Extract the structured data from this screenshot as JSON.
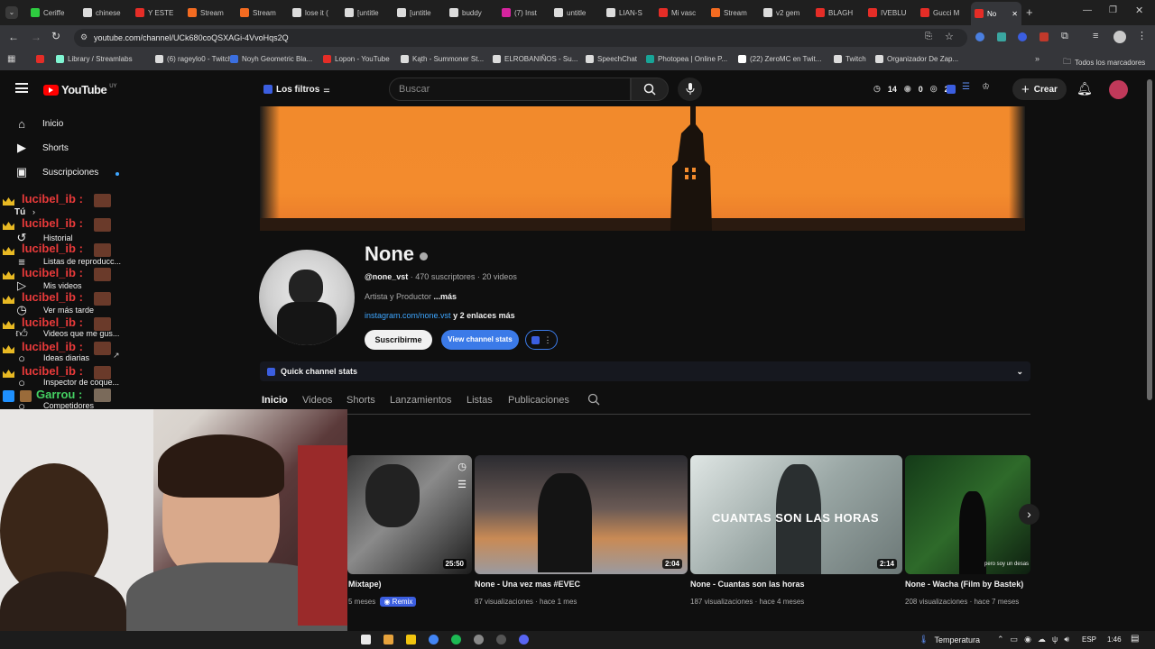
{
  "browser": {
    "tabs": [
      {
        "label": "Ceriffe",
        "color": "#2ecc40"
      },
      {
        "label": "chinese",
        "color": "#dcdcdc"
      },
      {
        "label": "Y ESTE",
        "color": "#e52d27"
      },
      {
        "label": "Stream",
        "color": "#f36b21"
      },
      {
        "label": "Stream",
        "color": "#f36b21"
      },
      {
        "label": "lose it (",
        "color": "#dcdcdc"
      },
      {
        "label": "[untitle",
        "color": "#dcdcdc"
      },
      {
        "label": "[untitle",
        "color": "#dcdcdc"
      },
      {
        "label": "buddy",
        "color": "#dcdcdc"
      },
      {
        "label": "(7) Inst",
        "color": "#d6249f"
      },
      {
        "label": "untitle",
        "color": "#dcdcdc"
      },
      {
        "label": "LIAN-S",
        "color": "#dcdcdc"
      },
      {
        "label": "Mi vasc",
        "color": "#e52d27"
      },
      {
        "label": "Stream",
        "color": "#f36b21"
      },
      {
        "label": "v2 gem",
        "color": "#dcdcdc"
      },
      {
        "label": "BLAGH",
        "color": "#e52d27"
      },
      {
        "label": "IVEBLU",
        "color": "#e52d27"
      },
      {
        "label": "Gucci M",
        "color": "#e52d27"
      },
      {
        "label": "No",
        "color": "#e52d27"
      }
    ],
    "url": "youtube.com/channel/UCk680coQSXAGi-4VvoHqs2Q",
    "bookmarks": [
      {
        "label": "",
        "color": "#e52d27"
      },
      {
        "label": "Library / Streamlabs",
        "color": "#80f5d2"
      },
      {
        "label": "(6) rageylo0 - Twitch",
        "color": "#dcdcdc"
      },
      {
        "label": "Noyh Geometric Bla...",
        "color": "#3b6fe0"
      },
      {
        "label": "Lopon - YouTube",
        "color": "#e52d27"
      },
      {
        "label": "Kąth - Summoner St...",
        "color": "#dcdcdc"
      },
      {
        "label": "ELROBANIÑOS - Su...",
        "color": "#dcdcdc"
      },
      {
        "label": "SpeechChat",
        "color": "#dcdcdc"
      },
      {
        "label": "Photopea | Online P...",
        "color": "#18a497"
      },
      {
        "label": "(22) ZeroMC en Twit...",
        "color": "#ffffff"
      },
      {
        "label": "Twitch",
        "color": "#dcdcdc"
      },
      {
        "label": "Organizador De Zap...",
        "color": "#dcdcdc"
      }
    ],
    "all_bookmarks": "Todos los marcadores"
  },
  "youtube": {
    "logo_text": "YouTube",
    "logo_country": "UY",
    "filter_label": "Los filtros",
    "search_placeholder": "Buscar",
    "stats": {
      "a": "14",
      "b": "0",
      "c": "2"
    },
    "create_label": "Crear",
    "sidebar": {
      "main": [
        {
          "label": "Inicio",
          "icon": "home-icon"
        },
        {
          "label": "Shorts",
          "icon": "shorts-icon"
        },
        {
          "label": "Suscripciones",
          "icon": "subscriptions-icon"
        }
      ],
      "you_label": "Tú",
      "you_items": [
        {
          "label": "Historial"
        },
        {
          "label": "Listas de reproducc..."
        },
        {
          "label": "Mis videos"
        },
        {
          "label": "Ver más tarde"
        },
        {
          "label": "Videos que me gus..."
        },
        {
          "label": "Ideas diarias"
        },
        {
          "label": "Inspector de coque..."
        },
        {
          "label": "Competidores"
        }
      ]
    },
    "chat": {
      "names": [
        "lucibel_ib :",
        "lucibel_ib :",
        "lucibel_ib :",
        "lucibel_ib :",
        "lucibel_ib :",
        "lucibel_ib :",
        "lucibel_ib :",
        "lucibel_ib :"
      ],
      "last_name": "Garrou :"
    },
    "channel": {
      "name": "None",
      "handle": "@none_vst",
      "subscribers": "470 suscriptores",
      "videos": "20 videos",
      "description": "Artista y Productor",
      "more": "...más",
      "link": "instagram.com/none.vst",
      "link_more": "y 2 enlaces más",
      "subscribe_label": "Suscribirme",
      "stats_label": "View channel stats",
      "quick_stats": "Quick channel stats",
      "tabs": [
        "Inicio",
        "Videos",
        "Shorts",
        "Lanzamientos",
        "Listas",
        "Publicaciones"
      ]
    },
    "videos": [
      {
        "title": "Mixtape)",
        "meta": "5 meses",
        "badge": "Remix",
        "duration": "25:50"
      },
      {
        "title": "None - Una vez mas #EVEC",
        "meta": "87 visualizaciones · hace 1 mes",
        "duration": "2:04"
      },
      {
        "title": "None - Cuantas son las horas",
        "meta": "187 visualizaciones · hace 4 meses",
        "duration": "2:14",
        "overlay": "CUANTAS SON LAS HORAS"
      },
      {
        "title": "None - Wacha (Film by Bastek)",
        "meta": "208 visualizaciones · hace 7 meses",
        "overlay": "pero soy un desas"
      }
    ]
  },
  "taskbar": {
    "weather": "Temperatura",
    "lang": "ESP",
    "time": "1:46"
  }
}
